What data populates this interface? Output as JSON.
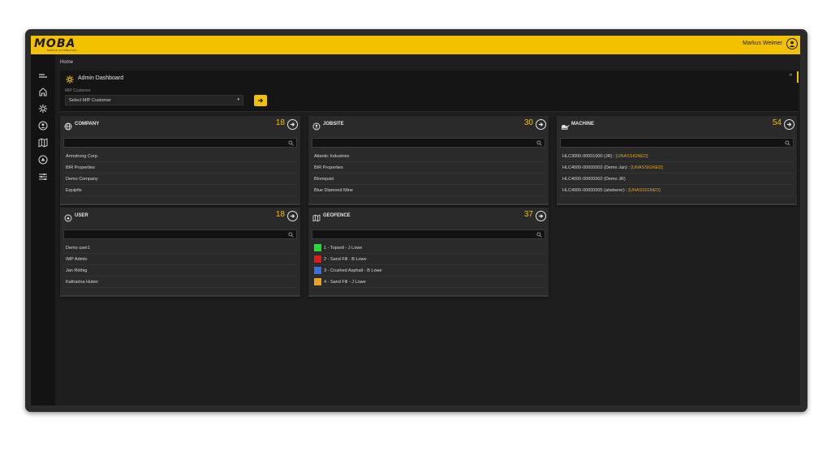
{
  "brand": {
    "logo": "MOBA",
    "tagline": "MOBILE AUTOMATION"
  },
  "user": {
    "name": "Markus Weimer"
  },
  "breadcrumb": "Home",
  "admin": {
    "title": "Admin Dashboard",
    "mip_label": "MIP Customer",
    "mip_placeholder": "Select MIP Customer"
  },
  "cards": {
    "company": {
      "title": "COMPANY",
      "count": "18",
      "items": [
        "Armstrong Corp.",
        "BIR Properties",
        "Demo Company",
        "Equipfix"
      ]
    },
    "jobsite": {
      "title": "JOBSITE",
      "count": "30",
      "items": [
        "Atlantic Industries",
        "BIR Properties",
        "Blomquist",
        "Blue Diamond Mine"
      ]
    },
    "machine": {
      "title": "MACHINE",
      "count": "54",
      "items": [
        {
          "name": "HLC3000-00001000 (JR) :",
          "tag": "[UNASSIGNED]"
        },
        {
          "name": "HLC4000-00000002 (Demo Jan) :",
          "tag": "[UNASSIGNED]"
        },
        {
          "name": "HLC4000-00000002 (Demo JR)",
          "tag": ""
        },
        {
          "name": "HLC4000-00000005 (aheberer) :",
          "tag": "[UNASSIGNED]"
        }
      ]
    },
    "user": {
      "title": "USER",
      "count": "18",
      "items": [
        "Demo user1",
        "IMP Admin",
        "Jan Röthig",
        "Katharina Huber"
      ]
    },
    "geofence": {
      "title": "GEOFENCE",
      "count": "37",
      "items": [
        {
          "label": "1 - Topsoil - J Lowe",
          "color": "#22dd33"
        },
        {
          "label": "2 - Sand Fill - B Lowe",
          "color": "#e01a1a"
        },
        {
          "label": "3 - Crushed Asphalt - B Lowe",
          "color": "#3a6fe0"
        },
        {
          "label": "4 - Sand Fill - J Lowe",
          "color": "#f0a020"
        }
      ]
    }
  },
  "colors": {
    "accent": "#f2c200",
    "tag": "#e0a020",
    "logout": "#e03030"
  },
  "icons": {
    "sidebar": [
      "menu-icon",
      "home-icon",
      "gear-icon",
      "user-circle-icon",
      "map-icon",
      "upload-circle-icon",
      "sliders-icon"
    ]
  }
}
